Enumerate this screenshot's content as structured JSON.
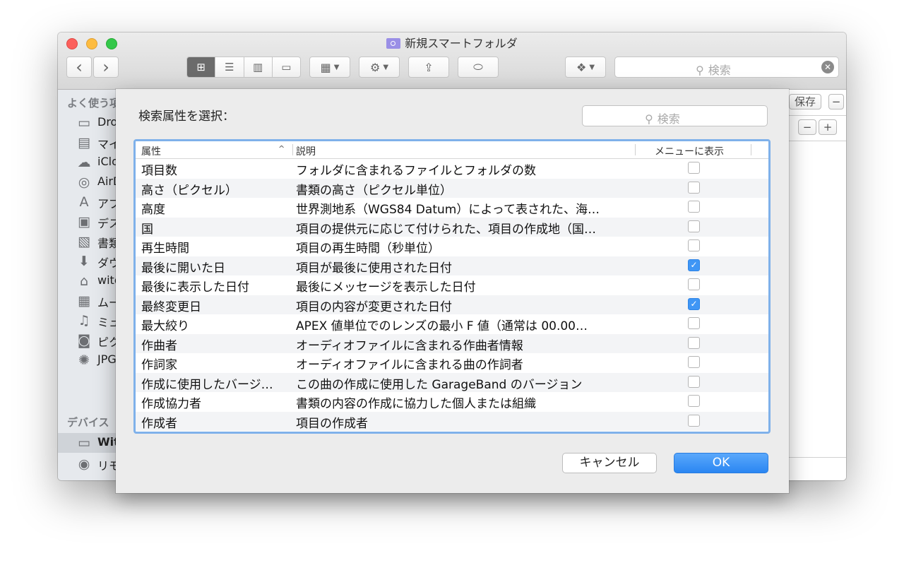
{
  "window": {
    "title": "新規スマートフォルダ",
    "search_placeholder": "検索"
  },
  "toolbar": {
    "back_icon": "‹",
    "forward_icon": "›",
    "view_icons": [
      "⊞",
      "☰",
      "▥",
      "▭"
    ],
    "arrange_icon": "▦",
    "action_icon": "⚙",
    "share_icon": "⇪",
    "tag_icon": "⬭",
    "dropbox_icon": "❖",
    "clear_icon": "✕"
  },
  "sidebar": {
    "favorites_label": "よく使う項目",
    "devices_label": "デバイス",
    "items": [
      {
        "icon": "▭",
        "label": "Dropbox"
      },
      {
        "icon": "▤",
        "label": "マイファイル"
      },
      {
        "icon": "☁",
        "label": "iCloud Drive"
      },
      {
        "icon": "◎",
        "label": "AirDrop"
      },
      {
        "icon": "A",
        "label": "アプリケーション"
      },
      {
        "icon": "▣",
        "label": "デスクトップ"
      },
      {
        "icon": "▧",
        "label": "書類"
      },
      {
        "icon": "⬇",
        "label": "ダウンロード"
      },
      {
        "icon": "⌂",
        "label": "witch"
      },
      {
        "icon": "▦",
        "label": "ムービー"
      },
      {
        "icon": "♫",
        "label": "ミュージック"
      },
      {
        "icon": "◙",
        "label": "ピクチャ"
      },
      {
        "icon": "✺",
        "label": "JPG"
      }
    ],
    "devices": [
      {
        "icon": "▭",
        "label": "Witch"
      },
      {
        "icon": "◉",
        "label": "リモートディスク"
      }
    ]
  },
  "right_panel": {
    "save_label": "保存",
    "minus": "−",
    "plus": "+"
  },
  "dialog": {
    "title": "検索属性を選択：",
    "search_placeholder": "検索",
    "columns": {
      "attribute": "属性",
      "sort_indicator": "^",
      "description": "説明",
      "show_in_menu": "メニューに表示"
    },
    "rows": [
      {
        "attribute": "項目数",
        "description": "フォルダに含まれるファイルとフォルダの数",
        "checked": false
      },
      {
        "attribute": "高さ（ピクセル）",
        "description": "書類の高さ（ピクセル単位）",
        "checked": false
      },
      {
        "attribute": "高度",
        "description": "世界測地系（WGS84 Datum）によって表された、海…",
        "checked": false
      },
      {
        "attribute": "国",
        "description": "項目の提供元に応じて付けられた、項目の作成地（国…",
        "checked": false
      },
      {
        "attribute": "再生時間",
        "description": "項目の再生時間（秒単位）",
        "checked": false
      },
      {
        "attribute": "最後に開いた日",
        "description": "項目が最後に使用された日付",
        "checked": true
      },
      {
        "attribute": "最後に表示した日付",
        "description": "最後にメッセージを表示した日付",
        "checked": false
      },
      {
        "attribute": "最終変更日",
        "description": "項目の内容が変更された日付",
        "checked": true
      },
      {
        "attribute": "最大絞り",
        "description": "APEX 値単位でのレンズの最小 F 値（通常は 00.00…",
        "checked": false
      },
      {
        "attribute": "作曲者",
        "description": "オーディオファイルに含まれる作曲者情報",
        "checked": false
      },
      {
        "attribute": "作詞家",
        "description": "オーディオファイルに含まれる曲の作詞者",
        "checked": false
      },
      {
        "attribute": "作成に使用したバージ…",
        "description": "この曲の作成に使用した GarageBand のバージョン",
        "checked": false
      },
      {
        "attribute": "作成協力者",
        "description": "書類の内容の作成に協力した個人または組織",
        "checked": false
      },
      {
        "attribute": "作成者",
        "description": "項目の作成者",
        "checked": false
      }
    ],
    "check_glyph": "✓",
    "cancel_label": "キャンセル",
    "ok_label": "OK"
  },
  "colors": {
    "accent": "#3f96f5",
    "focus_ring": "#7fb1ea"
  }
}
